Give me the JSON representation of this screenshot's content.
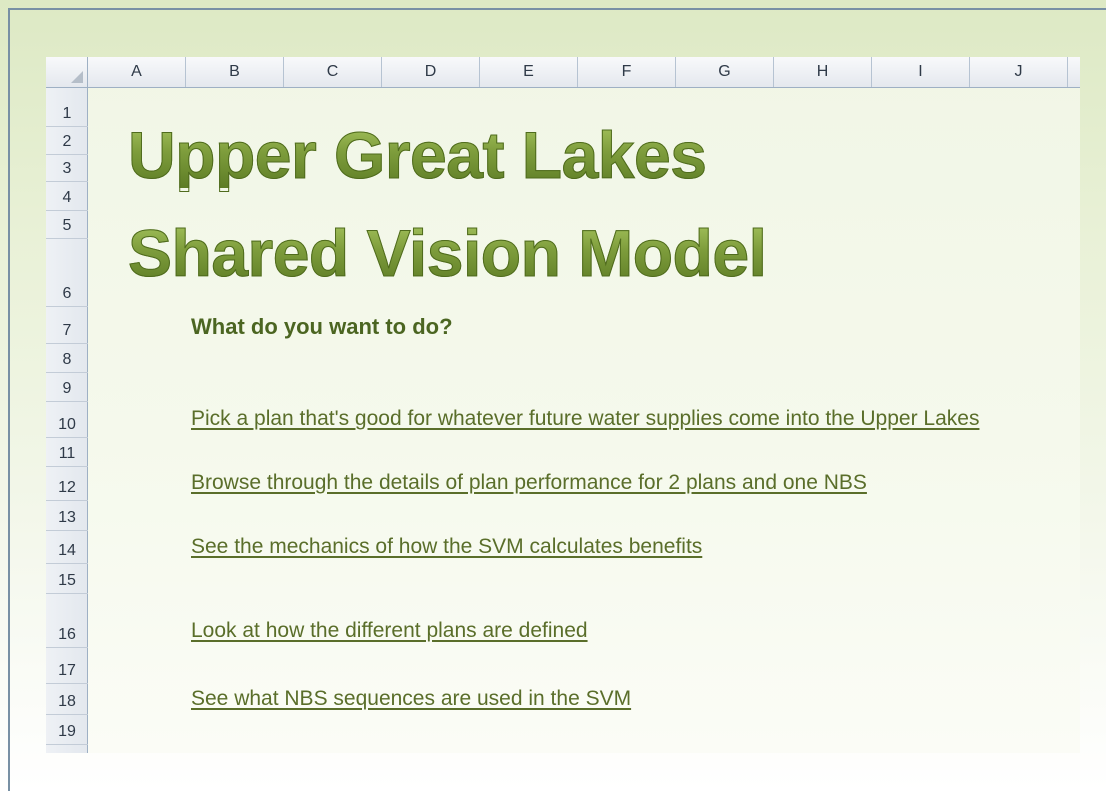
{
  "spreadsheet": {
    "columns": [
      "A",
      "B",
      "C",
      "D",
      "E",
      "F",
      "G",
      "H",
      "I",
      "J"
    ],
    "rows": [
      "1",
      "2",
      "3",
      "4",
      "5",
      "6",
      "7",
      "8",
      "9",
      "10",
      "11",
      "12",
      "13",
      "14",
      "15",
      "16",
      "17",
      "18",
      "19"
    ]
  },
  "title": {
    "line1": "Upper Great Lakes",
    "line2": "Shared Vision Model"
  },
  "prompt": "What do you want to do?",
  "links": [
    "Pick a plan that's good for whatever future water supplies come into the Upper Lakes",
    "Browse through the details of plan performance for 2 plans and one NBS",
    "See the mechanics of how the SVM calculates benefits",
    "Look at how the different plans are defined",
    "See what NBS sequences are used in the SVM"
  ],
  "colors": {
    "title_green": "#7e9d3c",
    "prompt_green": "#4b6521",
    "link_green": "#5a6e2a"
  }
}
